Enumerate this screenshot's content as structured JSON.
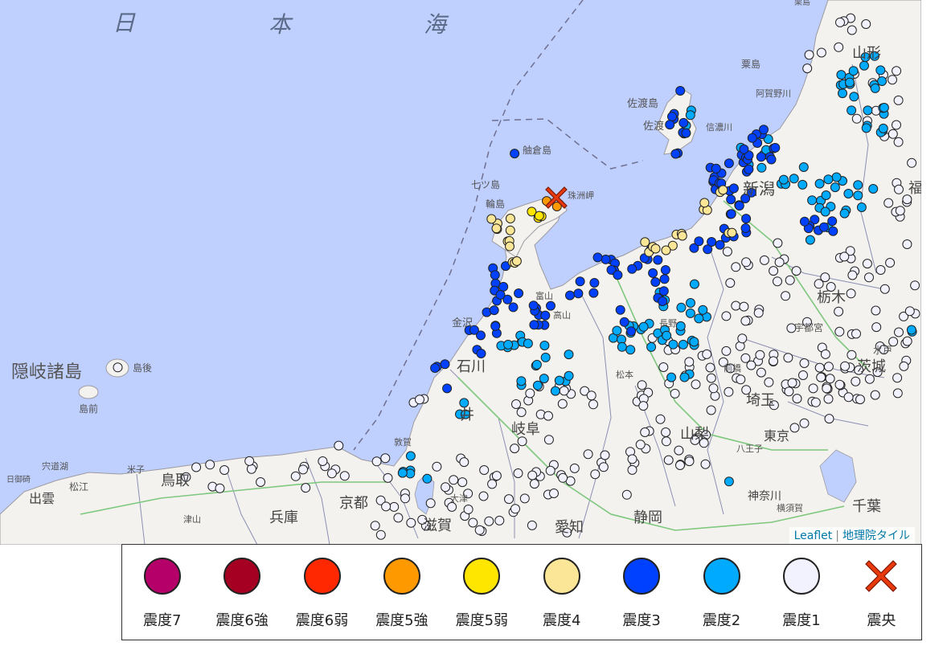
{
  "map": {
    "attribution": {
      "leaflet": "Leaflet",
      "separator": "|",
      "tiles": "地理院タイル"
    },
    "labels": [
      {
        "key": "sea-char-1",
        "text": "日"
      },
      {
        "key": "sea-char-2",
        "text": "本"
      },
      {
        "key": "sea-char-3",
        "text": "海"
      },
      {
        "key": "oki-islands",
        "text": "隠岐諸島"
      },
      {
        "key": "dogo",
        "text": "島後"
      },
      {
        "key": "dozen",
        "text": "島前"
      },
      {
        "key": "sado-island",
        "text": "佐渡島"
      },
      {
        "key": "sado",
        "text": "佐渡"
      },
      {
        "key": "hegura",
        "text": "舳倉島"
      },
      {
        "key": "nanatsu",
        "text": "七ツ島"
      },
      {
        "key": "wajima",
        "text": "輪島"
      },
      {
        "key": "suzu-cape",
        "text": "珠洲岬"
      },
      {
        "key": "niigata",
        "text": "新潟"
      },
      {
        "key": "yamagata",
        "text": "山形"
      },
      {
        "key": "awa-shima",
        "text": "粟島"
      },
      {
        "key": "agano",
        "text": "阿賀野川"
      },
      {
        "key": "shinano",
        "text": "信濃川"
      },
      {
        "key": "fukushima",
        "text": "福"
      },
      {
        "key": "kanazawa",
        "text": "金沢"
      },
      {
        "key": "ishikawa",
        "text": "石川"
      },
      {
        "key": "fukui",
        "text": "井"
      },
      {
        "key": "gifu",
        "text": "岐阜"
      },
      {
        "key": "tottori",
        "text": "鳥取"
      },
      {
        "key": "hyogo",
        "text": "兵庫"
      },
      {
        "key": "kyoto",
        "text": "京都"
      },
      {
        "key": "shiga",
        "text": "滋賀"
      },
      {
        "key": "aichi",
        "text": "愛知"
      },
      {
        "key": "shizuoka",
        "text": "静岡"
      },
      {
        "key": "yamanashi",
        "text": "山梨"
      },
      {
        "key": "saitama",
        "text": "埼玉"
      },
      {
        "key": "tokyo",
        "text": "東京"
      },
      {
        "key": "chiba",
        "text": "千葉"
      },
      {
        "key": "kanagawa",
        "text": "神奈川"
      },
      {
        "key": "tochigi",
        "text": "栃木"
      },
      {
        "key": "ibaraki",
        "text": "茨城"
      },
      {
        "key": "utsunomiya",
        "text": "宇都宮"
      },
      {
        "key": "mito",
        "text": "水戸"
      },
      {
        "key": "matsue",
        "text": "松江"
      },
      {
        "key": "izumo",
        "text": "出雲"
      },
      {
        "key": "hakata",
        "text": "日御碕"
      },
      {
        "key": "shinjiko",
        "text": "宍道湖"
      },
      {
        "key": "yonago",
        "text": "米子"
      },
      {
        "key": "tsuyama",
        "text": "津山"
      },
      {
        "key": "tsuruga",
        "text": "敦賀"
      },
      {
        "key": "ohtsu",
        "text": "大津"
      },
      {
        "key": "hachioji",
        "text": "八王子"
      },
      {
        "key": "yokosuka",
        "text": "横須賀"
      },
      {
        "key": "gunma",
        "text": "前橋"
      },
      {
        "key": "matsumoto",
        "text": "松本"
      },
      {
        "key": "takayama",
        "text": "高山"
      },
      {
        "key": "toyama-bay",
        "text": "富山"
      },
      {
        "key": "nagano",
        "text": "長野"
      },
      {
        "key": "kurihara",
        "text": "栗島"
      }
    ]
  },
  "epicenter": {
    "label": "震央",
    "color": "#e8380d"
  },
  "stations": [
    {
      "lvl": "4",
      "n": 28
    },
    {
      "lvl": "5-",
      "n": 4
    },
    {
      "lvl": "5+",
      "n": 2
    },
    {
      "lvl": "3",
      "n": 130
    },
    {
      "lvl": "2",
      "n": 130
    },
    {
      "lvl": "1",
      "n": 300
    }
  ],
  "legend": [
    {
      "label": "震度7",
      "color": "#b40068"
    },
    {
      "label": "震度6強",
      "color": "#a50021"
    },
    {
      "label": "震度6弱",
      "color": "#ff2800"
    },
    {
      "label": "震度5強",
      "color": "#ff9900"
    },
    {
      "label": "震度5弱",
      "color": "#ffe600"
    },
    {
      "label": "震度4",
      "color": "#fae696"
    },
    {
      "label": "震度3",
      "color": "#0041ff"
    },
    {
      "label": "震度2",
      "color": "#00aaff"
    },
    {
      "label": "震度1",
      "color": "#f2f2ff"
    },
    {
      "label": "震央",
      "color": "#e8380d",
      "icon": "x-mark-icon"
    }
  ]
}
